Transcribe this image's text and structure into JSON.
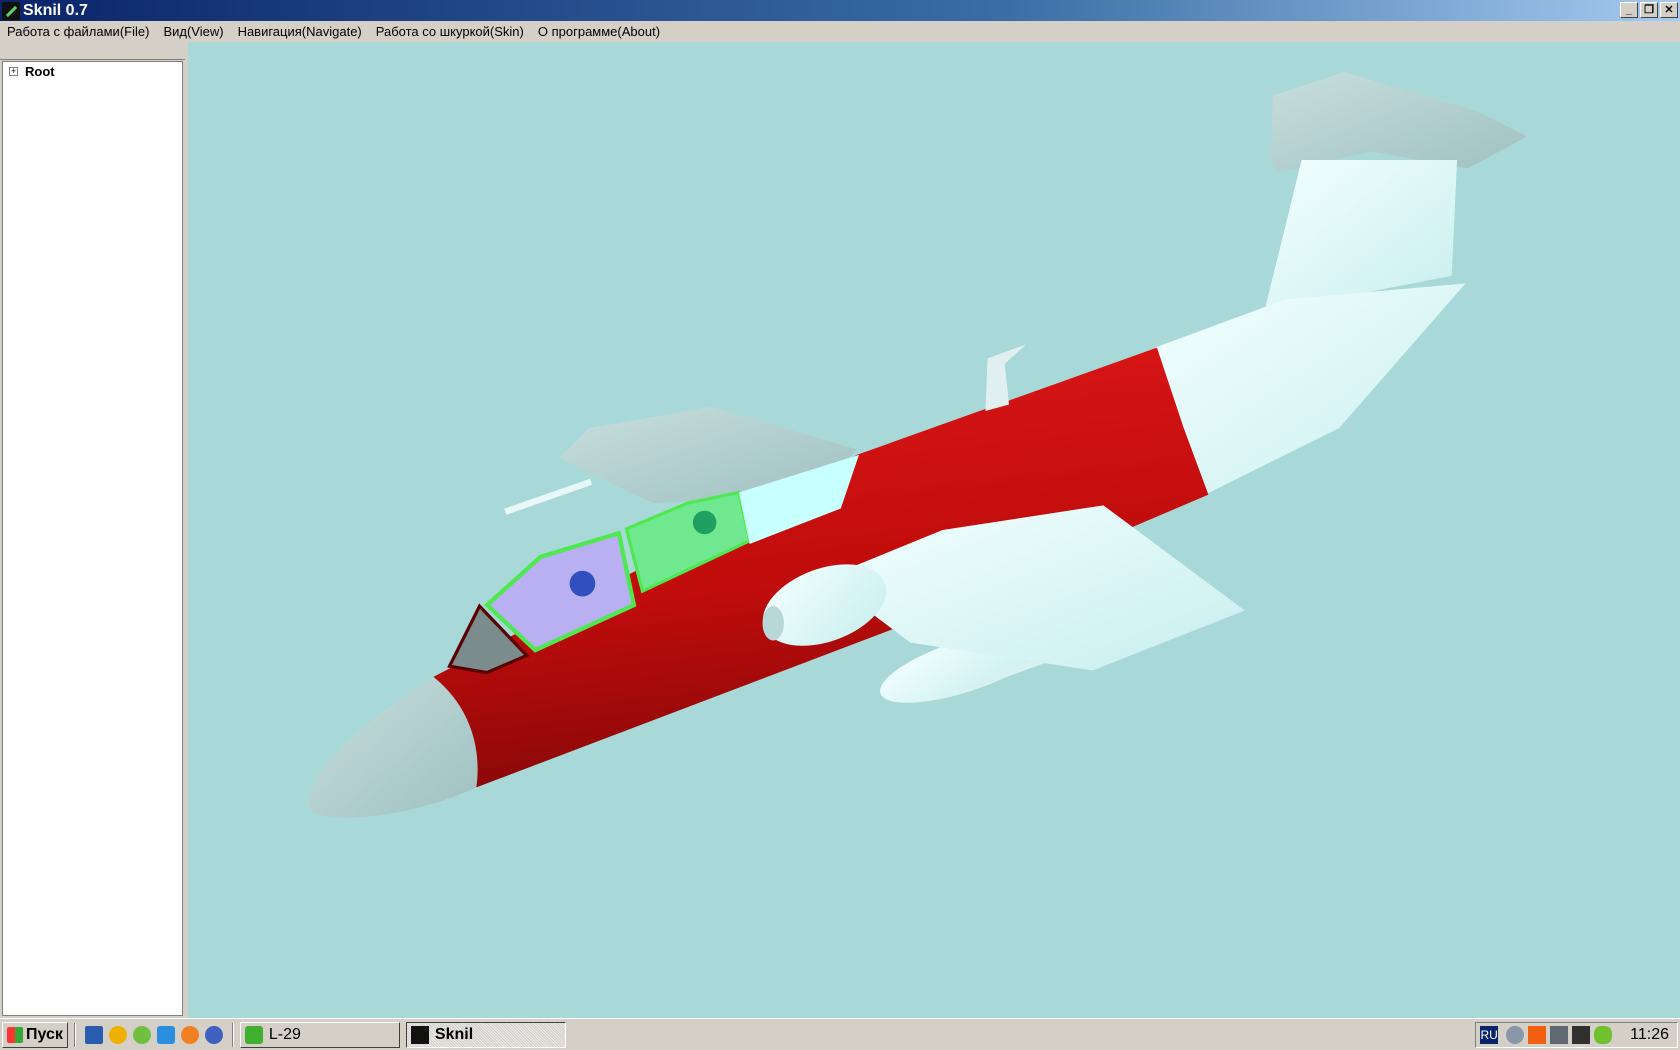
{
  "window": {
    "title": "Sknil 0.7",
    "controls": [
      "minimize",
      "restore",
      "close"
    ]
  },
  "menu": [
    "Работа с файлами(File)",
    "Вид(View)",
    "Навигация(Navigate)",
    "Работа со шкуркой(Skin)",
    "О программе(About)"
  ],
  "tree": {
    "root_label": "Root",
    "expander": "+"
  },
  "viewport": {
    "background": "#a8d8d8",
    "fuselage_color": "#c81010"
  },
  "taskbar": {
    "start_label": "Пуск",
    "quick_launch": [
      "show-desktop-icon",
      "aimp-icon",
      "utorrent-icon",
      "home-icon",
      "settings-icon",
      "media-player-icon"
    ],
    "tasks": [
      {
        "label": "L-29",
        "active": false
      },
      {
        "label": "Sknil",
        "active": true
      }
    ],
    "tray": {
      "language": "RU",
      "icons": [
        "webcam-icon",
        "avast-icon",
        "printer-icon",
        "device-icon",
        "nvidia-icon"
      ],
      "clock": "11:26"
    }
  }
}
